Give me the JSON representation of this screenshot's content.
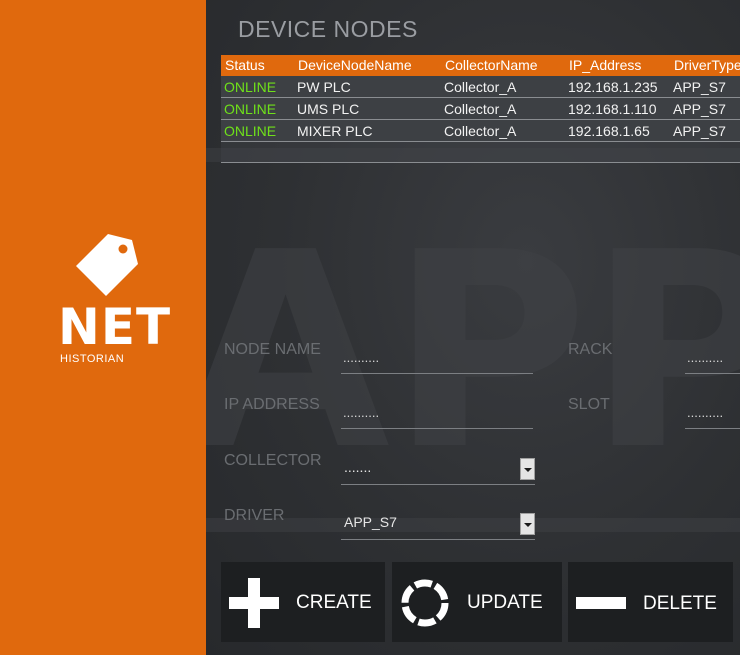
{
  "brand": {
    "name": "NET",
    "subtitle": "HISTORIAN"
  },
  "watermark_text": "APP",
  "page_title": "DEVICE NODES",
  "table": {
    "columns": [
      "Status",
      "DeviceNodeName",
      "CollectorName",
      "IP_Address",
      "DriverType"
    ],
    "rows": [
      {
        "status": "ONLINE",
        "name": "PW PLC",
        "collector": "Collector_A",
        "ip": "192.168.1.235",
        "driver": "APP_S7"
      },
      {
        "status": "ONLINE",
        "name": "UMS PLC",
        "collector": "Collector_A",
        "ip": "192.168.1.110",
        "driver": "APP_S7"
      },
      {
        "status": "ONLINE",
        "name": "MIXER PLC",
        "collector": "Collector_A",
        "ip": "192.168.1.65",
        "driver": "APP_S7"
      }
    ]
  },
  "form": {
    "node_name": {
      "label": "NODE NAME",
      "value": ".........."
    },
    "ip_address": {
      "label": "IP ADDRESS",
      "value": ".........."
    },
    "rack": {
      "label": "RACK",
      "value": ".........."
    },
    "slot": {
      "label": "SLOT",
      "value": ".........."
    },
    "collector": {
      "label": "COLLECTOR",
      "value": "......."
    },
    "driver": {
      "label": "DRIVER",
      "value": "APP_S7"
    }
  },
  "buttons": {
    "create": "CREATE",
    "update": "UPDATE",
    "delete": "DELETE"
  },
  "colors": {
    "accent": "#e0690d",
    "online": "#6fe01a",
    "panel": "#2b2d30",
    "button": "#1d1f21"
  }
}
